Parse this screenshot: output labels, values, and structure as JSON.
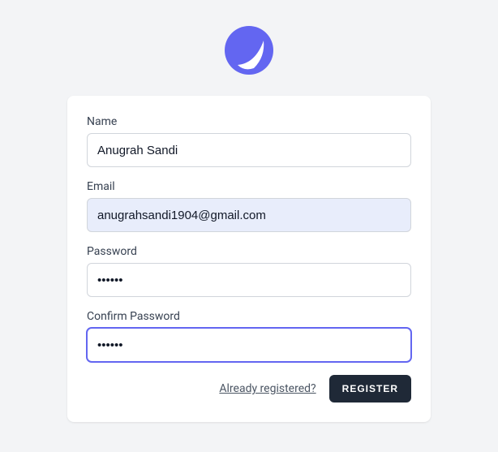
{
  "form": {
    "name_label": "Name",
    "name_value": "Anugrah Sandi",
    "email_label": "Email",
    "email_value": "anugrahsandi1904@gmail.com",
    "password_label": "Password",
    "password_value": "••••••",
    "confirm_label": "Confirm Password",
    "confirm_value": "••••••"
  },
  "actions": {
    "already_registered": "Already registered?",
    "register": "REGISTER"
  },
  "colors": {
    "brand": "#6366f1",
    "button_bg": "#1f2937",
    "page_bg": "#f3f4f6",
    "card_bg": "#ffffff",
    "autofill_bg": "#e8edfb"
  }
}
